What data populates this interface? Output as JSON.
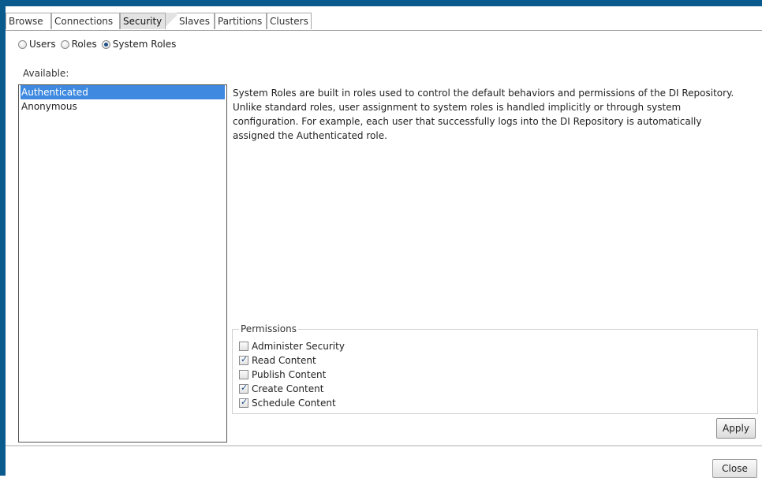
{
  "tabs": [
    {
      "label": "Browse",
      "active": false
    },
    {
      "label": "Connections",
      "active": false
    },
    {
      "label": "Security",
      "active": true
    },
    {
      "label": "Slaves",
      "active": false
    },
    {
      "label": "Partitions",
      "active": false
    },
    {
      "label": "Clusters",
      "active": false
    }
  ],
  "role_type": {
    "options": [
      {
        "label": "Users",
        "checked": false
      },
      {
        "label": "Roles",
        "checked": false
      },
      {
        "label": "System Roles",
        "checked": true
      }
    ]
  },
  "available": {
    "label": "Available:",
    "items": [
      {
        "label": "Authenticated",
        "selected": true
      },
      {
        "label": "Anonymous",
        "selected": false
      }
    ]
  },
  "description": "System Roles are built in roles used to control the default behaviors and permissions of the DI Repository. Unlike standard roles, user assignment to system roles is handled implicitly or through system configuration. For example, each user that successfully logs into the DI Repository is automatically assigned the Authenticated role.",
  "permissions": {
    "title": "Permissions",
    "items": [
      {
        "label": "Administer Security",
        "checked": false
      },
      {
        "label": "Read Content",
        "checked": true
      },
      {
        "label": "Publish Content",
        "checked": false
      },
      {
        "label": "Create Content",
        "checked": true
      },
      {
        "label": "Schedule Content",
        "checked": true
      }
    ]
  },
  "buttons": {
    "apply": "Apply",
    "close": "Close"
  },
  "colors": {
    "selection": "#3f8ae0",
    "frame": "#0b5a8e"
  }
}
